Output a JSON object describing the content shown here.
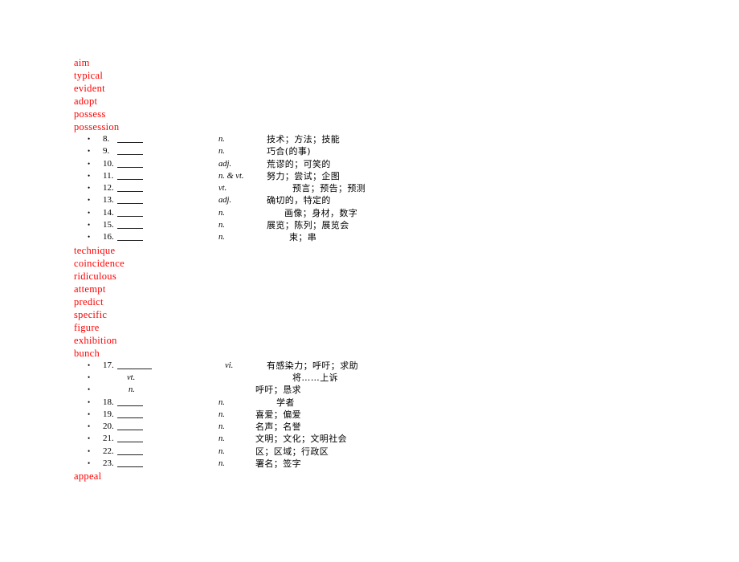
{
  "slide": {
    "background_color": "#ffffff",
    "accent_color": "#ff0000",
    "text_color": "#000000"
  },
  "word_group_1": {
    "words": [
      "aim",
      "typical",
      "evident",
      "adopt",
      "possess",
      "possession"
    ]
  },
  "definitions_1": {
    "rows": [
      {
        "bullet": "•",
        "number": "8.",
        "blank": "______",
        "pos": "n.",
        "cn": "技术；方法；技能"
      },
      {
        "bullet": "•",
        "number": "9.",
        "blank": "______",
        "pos": "n.",
        "cn": "巧合(的事)"
      },
      {
        "bullet": "•",
        "number": "10.",
        "blank": "_____",
        "pos": "adj.",
        "cn": "荒谬的；可笑的"
      },
      {
        "bullet": "•",
        "number": "11.",
        "blank": "_____",
        "pos": "n. & vt.",
        "cn": "努力；尝试；企图"
      },
      {
        "bullet": "•",
        "number": "12.",
        "blank": "_____",
        "pos": "vt.",
        "cn": "预言；预告；预测"
      },
      {
        "bullet": "•",
        "number": "13.",
        "blank": "_____",
        "pos": "adj.",
        "cn": "确切的，特定的"
      },
      {
        "bullet": "•",
        "number": "14.",
        "blank": "_____",
        "pos": "n.",
        "cn": "画像；身材，数字"
      },
      {
        "bullet": "•",
        "number": "15.",
        "blank": "_____",
        "pos": "n.",
        "cn": "展览；陈列；展览会"
      },
      {
        "bullet": "•",
        "number": "16.",
        "blank": "_____",
        "pos": "n.",
        "cn": "束；串"
      }
    ]
  },
  "word_group_2": {
    "words": [
      "technique",
      "coincidence",
      "ridiculous",
      "attempt",
      "predict",
      "specific",
      "figure",
      "exhibition",
      "bunch"
    ]
  },
  "definitions_2": {
    "rows": [
      {
        "bullet": "•",
        "number": "17.",
        "blank": "_______",
        "pos": "vi.",
        "cn": "有感染力；呼吁；求助"
      },
      {
        "bullet": "•",
        "number": "",
        "blank": "",
        "pos": "vt.",
        "cn": "将……上诉"
      },
      {
        "bullet": "•",
        "number": "",
        "blank": "",
        "pos": "n.",
        "cn": "呼吁；恳求"
      },
      {
        "bullet": "•",
        "number": "18.",
        "blank": "_____",
        "pos": "n.",
        "cn": "学者"
      },
      {
        "bullet": "•",
        "number": "19.",
        "blank": "_____",
        "pos": "n.",
        "cn": "喜爱；偏爱"
      },
      {
        "bullet": "•",
        "number": "20.",
        "blank": "_____",
        "pos": "n.",
        "cn": "名声；名誉"
      },
      {
        "bullet": "•",
        "number": "21.",
        "blank": "_____",
        "pos": "n.",
        "cn": "文明；文化；文明社会"
      },
      {
        "bullet": "•",
        "number": "22.",
        "blank": "_____",
        "pos": "n.",
        "cn": "区；区域；行政区"
      },
      {
        "bullet": "•",
        "number": "23.",
        "blank": "_____",
        "pos": "n.",
        "cn": "署名；签字"
      }
    ]
  },
  "word_group_3": {
    "words": [
      "appeal"
    ]
  }
}
